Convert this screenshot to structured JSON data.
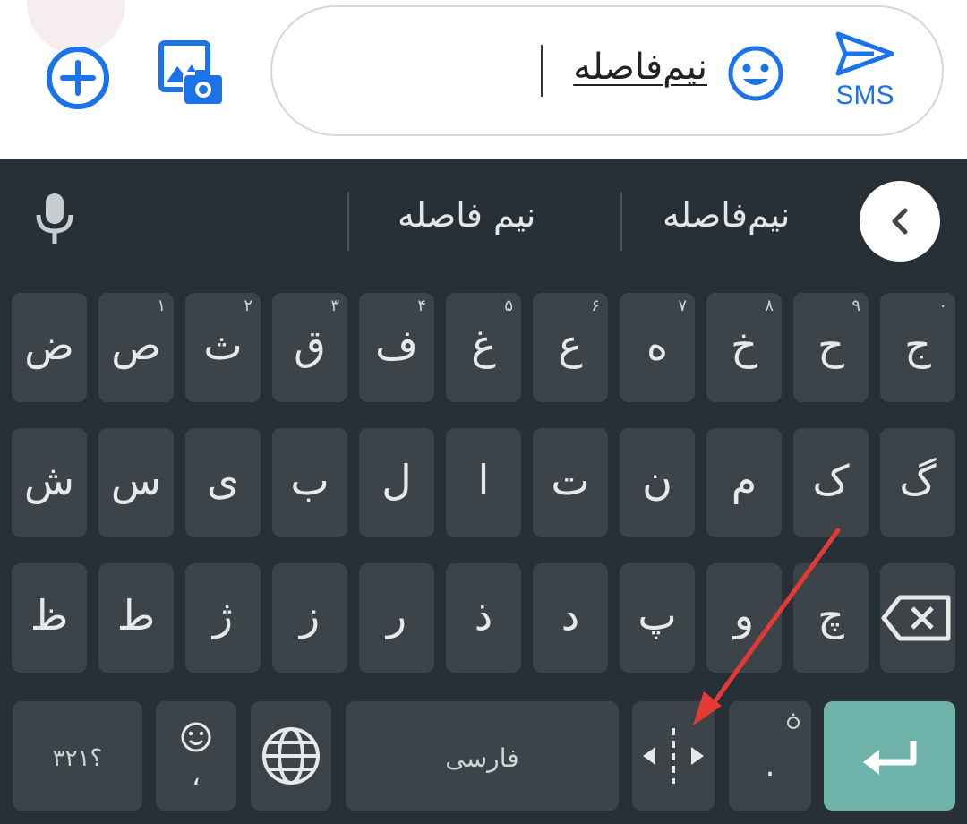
{
  "composer": {
    "message_text": "نیم‌فاصله",
    "send_label": "SMS",
    "icons": [
      "add-icon",
      "gallery-camera-icon",
      "emoji-icon",
      "send-icon"
    ]
  },
  "colors": {
    "accent": "#1a73e8",
    "keyboard_bg": "#263036",
    "key_bg": "#3c4449",
    "enter_key_bg": "#6fb2aa",
    "arrow": "#e53935"
  },
  "suggestions": {
    "items": [
      "نیم‌فاصله",
      "نیم فاصله"
    ]
  },
  "rows": {
    "row1": [
      {
        "char": "ج",
        "hint": "۰"
      },
      {
        "char": "ح",
        "hint": "۹"
      },
      {
        "char": "خ",
        "hint": "۸"
      },
      {
        "char": "ه",
        "hint": "۷"
      },
      {
        "char": "ع",
        "hint": "۶"
      },
      {
        "char": "غ",
        "hint": "۵"
      },
      {
        "char": "ف",
        "hint": "۴"
      },
      {
        "char": "ق",
        "hint": "۳"
      },
      {
        "char": "ث",
        "hint": "۲"
      },
      {
        "char": "ص",
        "hint": "۱"
      },
      {
        "char": "ض",
        "hint": ""
      }
    ],
    "row2": [
      "گ",
      "ک",
      "م",
      "ن",
      "ت",
      "ا",
      "ل",
      "ب",
      "ی",
      "س",
      "ش"
    ],
    "row3": [
      "چ",
      "و",
      "پ",
      "د",
      "ذ",
      "ر",
      "ز",
      "ژ",
      "ط",
      "ظ"
    ]
  },
  "bottom": {
    "symbols_label": "؟۳۲۱",
    "comma_label": "،",
    "space_label": "فارسی",
    "period_label": "."
  }
}
